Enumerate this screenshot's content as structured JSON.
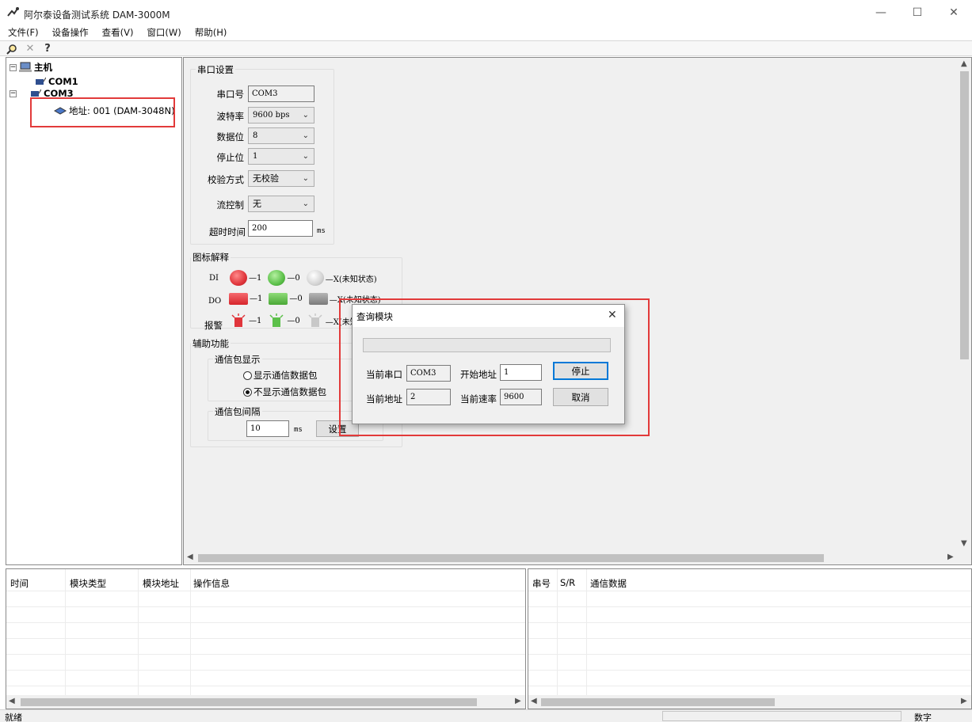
{
  "window": {
    "title": "阿尔泰设备测试系统 DAM-3000M",
    "minimize": "—",
    "maximize": "☐",
    "close": "✕"
  },
  "menu": [
    "文件(F)",
    "设备操作",
    "查看(V)",
    "窗口(W)",
    "帮助(H)"
  ],
  "toolbar": {
    "search": "search-icon",
    "delete": "close-icon",
    "help": "help-icon"
  },
  "tree": {
    "root": "主机",
    "com1": "COM1",
    "com3": "COM3",
    "device": "地址: 001 (DAM-3048N)"
  },
  "serial": {
    "group_title": "串口设置",
    "port_label": "串口号",
    "port_value": "COM3",
    "baud_label": "波特率",
    "baud_value": "9600 bps",
    "databits_label": "数据位",
    "databits_value": "8",
    "stopbits_label": "停止位",
    "stopbits_value": "1",
    "parity_label": "校验方式",
    "parity_value": "无校验",
    "flow_label": "流控制",
    "flow_value": "无",
    "timeout_label": "超时时间",
    "timeout_value": "200",
    "timeout_unit": "ms"
  },
  "legend": {
    "group_title": "图标解释",
    "di_label": "DI",
    "do_label": "DO",
    "alarm_label": "报警",
    "one": "—1",
    "zero": "—0",
    "unknown": "—X(未知状态)",
    "colors": {
      "red": "#e0353b",
      "green": "#5cc04a",
      "gray": "#c8c8c8"
    }
  },
  "aux": {
    "group_title": "辅助功能",
    "packet_group": "通信包显示",
    "show_packets": "显示通信数据包",
    "hide_packets": "不显示通信数据包",
    "interval_group": "通信包间隔",
    "interval_value": "10",
    "interval_unit": "ms",
    "set_button": "设置"
  },
  "dialog": {
    "title": "查询模块",
    "progress": 0,
    "cur_port_label": "当前串口",
    "cur_port_value": "COM3",
    "start_addr_label": "开始地址",
    "start_addr_value": "1",
    "cur_addr_label": "当前地址",
    "cur_addr_value": "2",
    "cur_rate_label": "当前速率",
    "cur_rate_value": "9600",
    "stop_button": "停止",
    "cancel_button": "取消"
  },
  "log_table": {
    "headers": [
      "时间",
      "模块类型",
      "模块地址",
      "操作信息"
    ]
  },
  "comm_table": {
    "headers": [
      "串号",
      "S/R",
      "通信数据"
    ]
  },
  "status": {
    "ready": "就绪",
    "numlock": "数字"
  }
}
